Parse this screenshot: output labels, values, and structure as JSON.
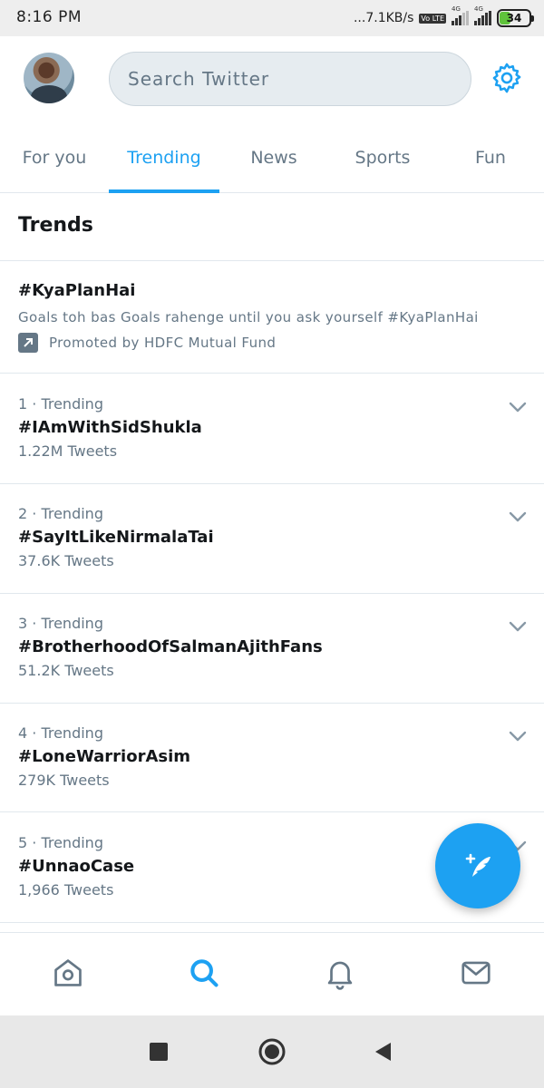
{
  "status_bar": {
    "time": "8:16 PM",
    "net_speed": "...7.1KB/s",
    "volte": "Vo LTE",
    "net_type_1": "4G",
    "net_type_2": "4G",
    "battery_percent": "34",
    "battery_level": 0.34
  },
  "header": {
    "search_placeholder": "Search Twitter",
    "settings_icon": "gear-icon",
    "avatar": "profile-avatar"
  },
  "tabs": [
    {
      "label": "For you",
      "active": false
    },
    {
      "label": "Trending",
      "active": true
    },
    {
      "label": "News",
      "active": false
    },
    {
      "label": "Sports",
      "active": false
    },
    {
      "label": "Fun",
      "active": false
    }
  ],
  "section_title": "Trends",
  "promoted": {
    "hashtag": "#KyaPlanHai",
    "description": "Goals toh bas Goals rahenge until you ask yourself #KyaPlanHai",
    "promoted_by": "Promoted by HDFC Mutual Fund",
    "icon": "promoted-arrow-icon"
  },
  "trends": [
    {
      "meta": "1 · Trending",
      "hashtag": "#IAmWithSidShukla",
      "count": "1.22M Tweets"
    },
    {
      "meta": "2 · Trending",
      "hashtag": "#SayItLikeNirmalaTai",
      "count": "37.6K Tweets"
    },
    {
      "meta": "3 · Trending",
      "hashtag": "#BrotherhoodOfSalmanAjithFans",
      "count": "51.2K Tweets"
    },
    {
      "meta": "4 · Trending",
      "hashtag": "#LoneWarriorAsim",
      "count": "279K Tweets"
    },
    {
      "meta": "5 · Trending",
      "hashtag": "#UnnaoCase",
      "count": "1,966 Tweets"
    }
  ],
  "fab": {
    "icon": "compose-tweet-icon"
  },
  "bottom_nav": [
    {
      "icon": "home-icon",
      "active": false
    },
    {
      "icon": "search-icon",
      "active": true
    },
    {
      "icon": "notifications-bell-icon",
      "active": false
    },
    {
      "icon": "messages-envelope-icon",
      "active": false
    }
  ],
  "system_nav": [
    {
      "icon": "recents-square-icon"
    },
    {
      "icon": "home-circle-icon"
    },
    {
      "icon": "back-triangle-icon"
    }
  ],
  "colors": {
    "accent": "#1da1f2",
    "text_primary": "#14171a",
    "text_secondary": "#657786",
    "divider": "#e1e8ed",
    "battery_fill": "#5fc33b"
  }
}
